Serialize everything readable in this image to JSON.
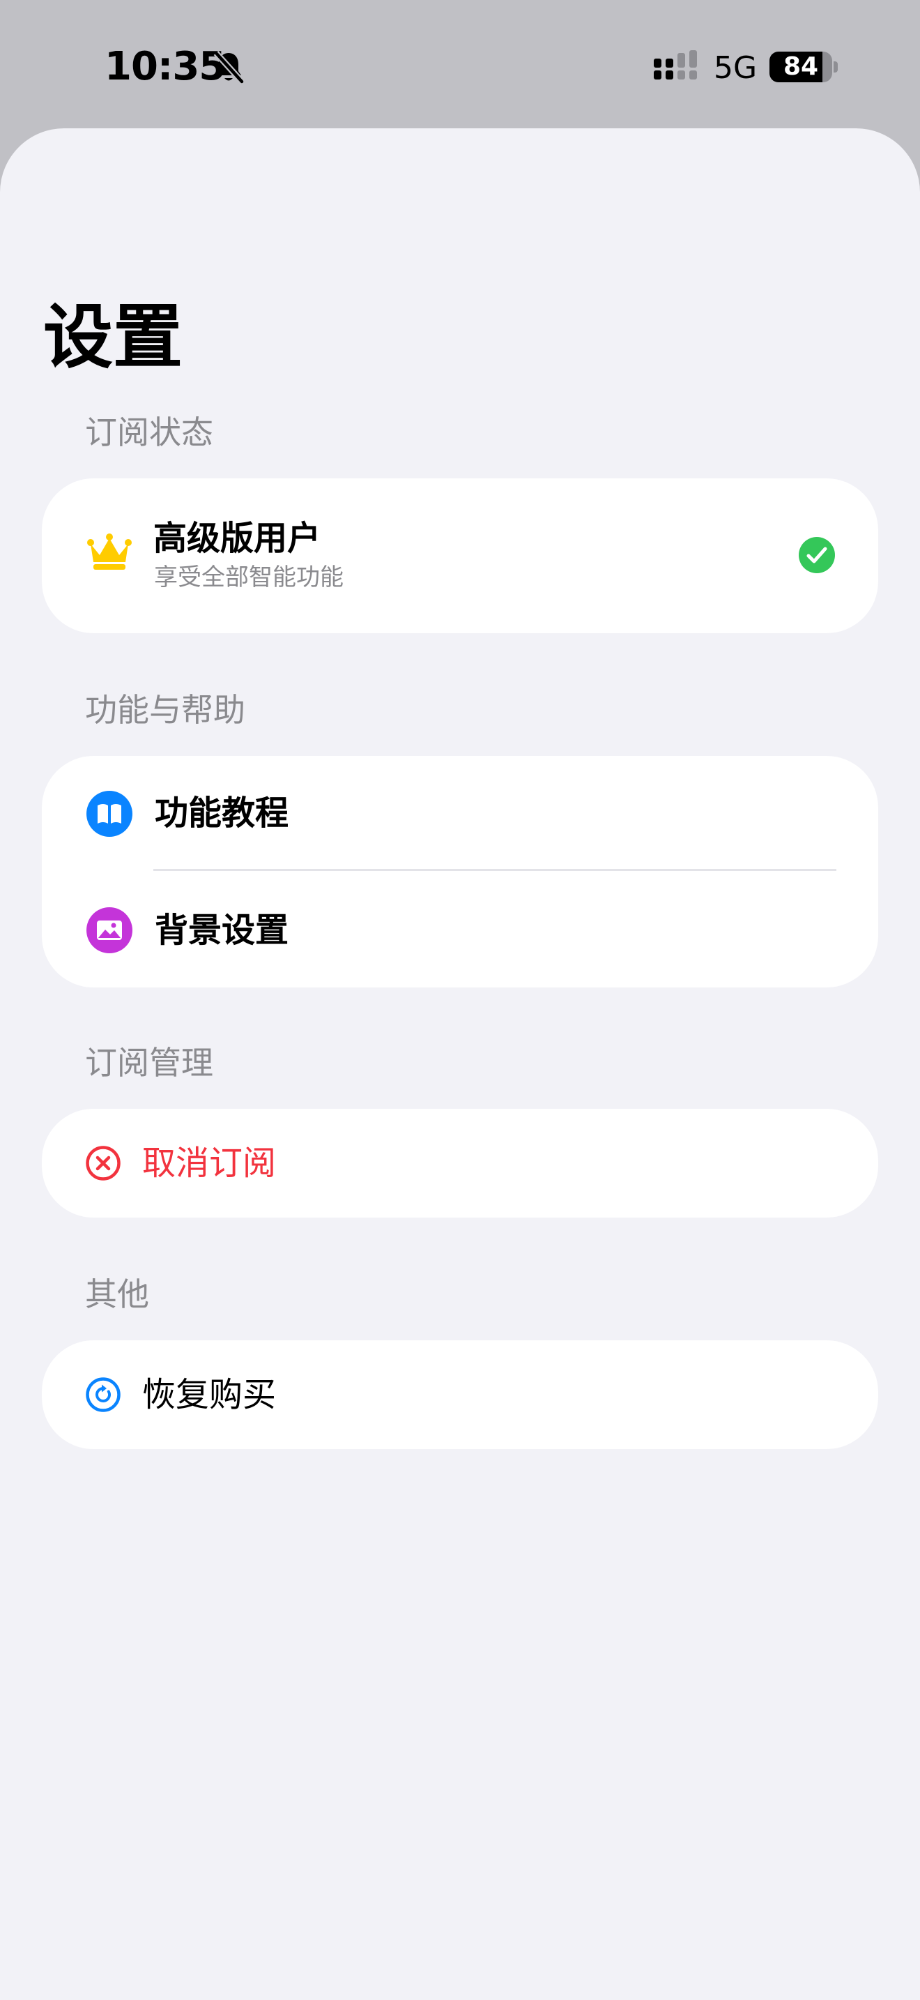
{
  "status_bar": {
    "time": "10:35",
    "network": "5G",
    "battery": "84",
    "battery_level": 0.84
  },
  "page": {
    "title": "设置"
  },
  "sections": {
    "subscription_status": {
      "header": "订阅状态",
      "title": "高级版用户",
      "subtitle": "享受全部智能功能",
      "icon": "crown-icon",
      "status_icon": "checkmark-circle-icon",
      "colors": {
        "crown": "#FFCC00",
        "check": "#34C759"
      }
    },
    "features_help": {
      "header": "功能与帮助",
      "items": [
        {
          "label": "功能教程",
          "icon": "book-icon",
          "color": "#0A84FF"
        },
        {
          "label": "背景设置",
          "icon": "photo-icon",
          "color": "#C434D9"
        }
      ]
    },
    "subscription_management": {
      "header": "订阅管理",
      "cancel_label": "取消订阅",
      "icon": "cancel-circle-icon",
      "color": "#F2333E"
    },
    "other": {
      "header": "其他",
      "restore_label": "恢复购买",
      "icon": "restore-icon",
      "color": "#0A84FF"
    }
  }
}
